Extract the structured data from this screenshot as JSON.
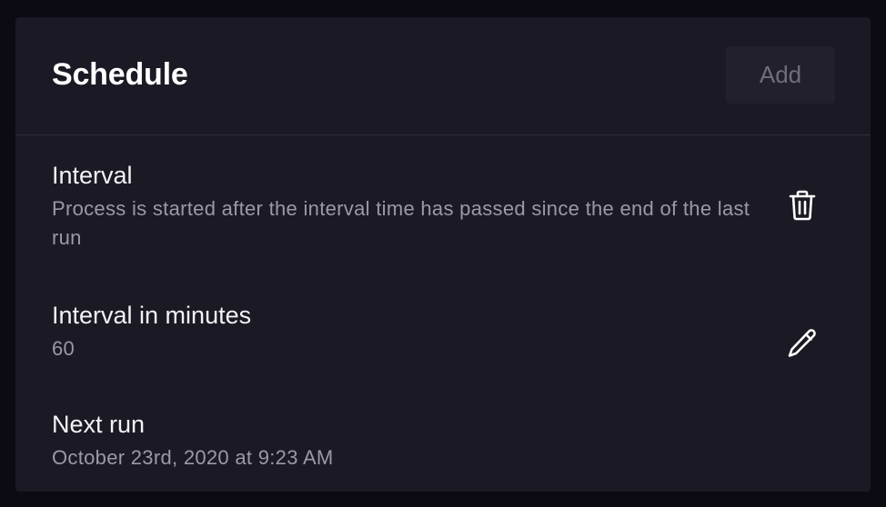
{
  "schedule": {
    "title": "Schedule",
    "add_label": "Add",
    "interval": {
      "title": "Interval",
      "description": "Process is started after the interval time has passed since the end of the last run",
      "action_icon": "trash-icon"
    },
    "interval_minutes": {
      "title": "Interval in minutes",
      "value": "60",
      "action_icon": "pencil-icon"
    },
    "next_run": {
      "title": "Next run",
      "value": "October 23rd, 2020 at 9:23 AM"
    }
  },
  "colors": {
    "page_background": "#0c0b14",
    "card_background": "#1a1924",
    "divider": "#2e2d3a",
    "button_background": "#21202b",
    "button_text_disabled": "#6f6e7c",
    "primary_text": "#f2f2f6",
    "secondary_text": "#9a99a8"
  }
}
